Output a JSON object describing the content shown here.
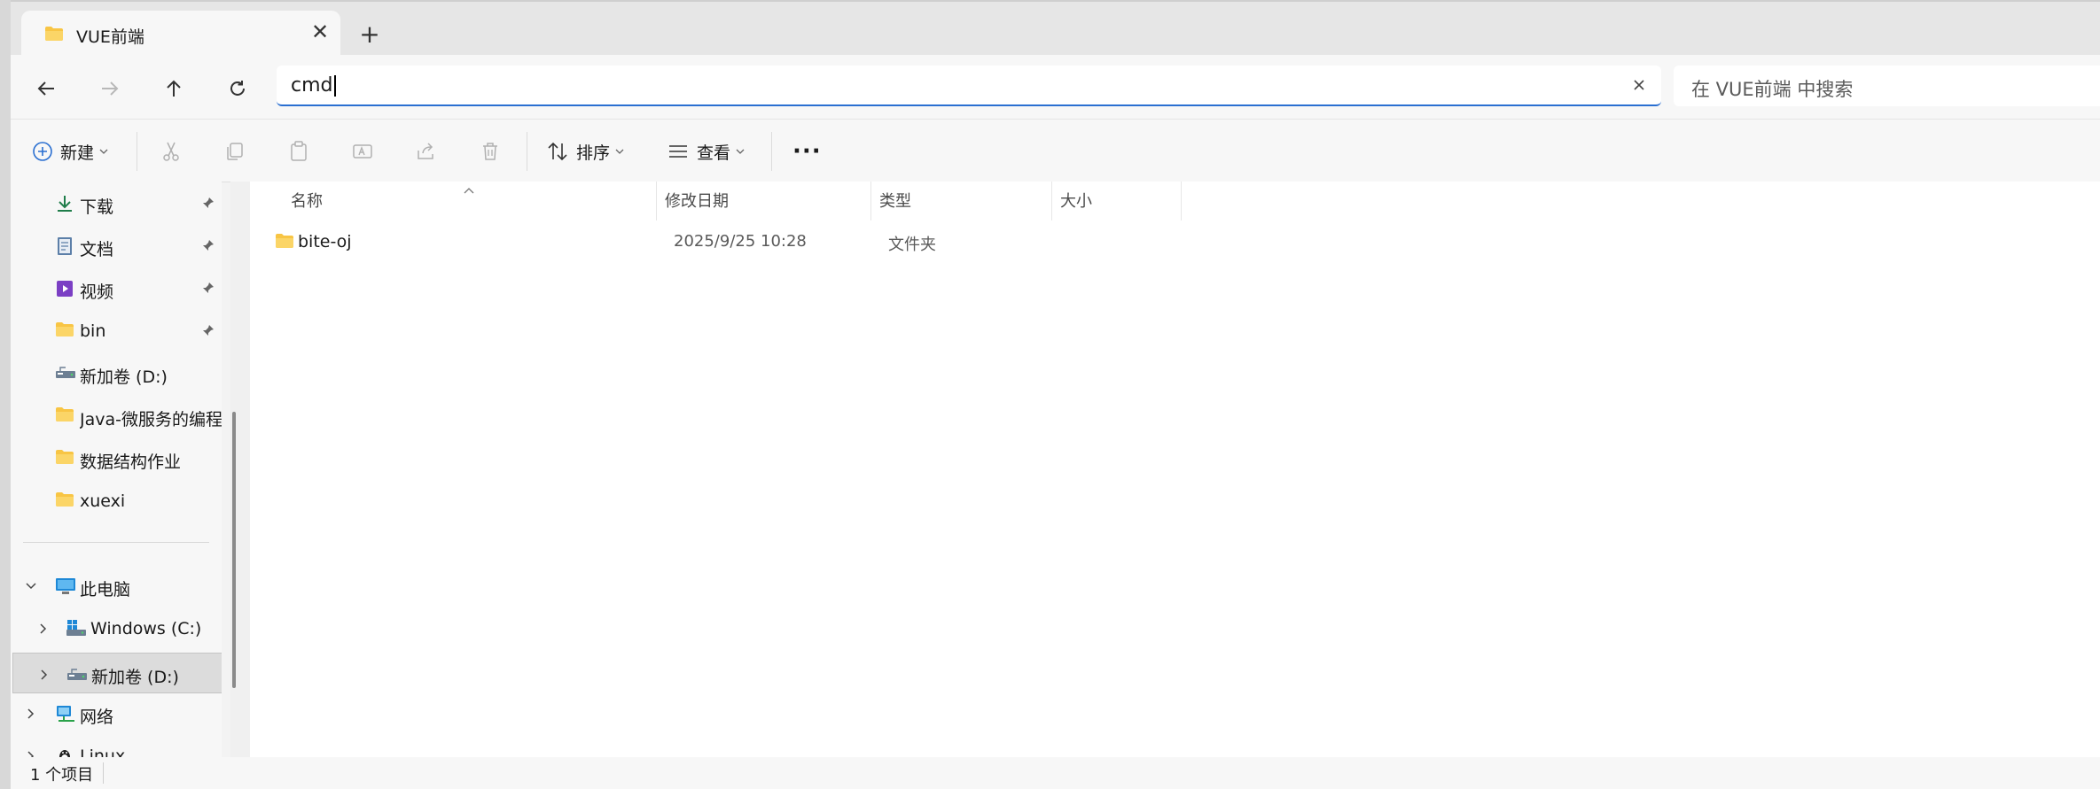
{
  "tab": {
    "title": "VUE前端",
    "close": "✕",
    "new_tab": "+"
  },
  "address": {
    "value": "cmd"
  },
  "search": {
    "placeholder": "在 VUE前端 中搜索"
  },
  "toolbar": {
    "new_label": "新建",
    "sort_label": "排序",
    "view_label": "查看",
    "more": "···"
  },
  "sidebar": {
    "items": [
      {
        "label": "下载",
        "icon": "download-icon",
        "pinned": true
      },
      {
        "label": "文档",
        "icon": "document-icon",
        "pinned": true
      },
      {
        "label": "视频",
        "icon": "video-icon",
        "pinned": true
      },
      {
        "label": "bin",
        "icon": "folder-icon",
        "pinned": true
      },
      {
        "label": "新加卷 (D:)",
        "icon": "drive-icon",
        "pinned": false
      },
      {
        "label": "Java-微服务的编程题",
        "icon": "folder-icon",
        "pinned": false
      },
      {
        "label": "数据结构作业",
        "icon": "folder-icon",
        "pinned": false
      },
      {
        "label": "xuexi",
        "icon": "folder-icon",
        "pinned": false
      }
    ],
    "tree": [
      {
        "label": "此电脑",
        "icon": "computer-icon",
        "expanded": true
      },
      {
        "label": "Windows (C:)",
        "icon": "windows-drive-icon",
        "expanded": false
      },
      {
        "label": "新加卷 (D:)",
        "icon": "drive-icon",
        "expanded": false,
        "selected": true
      },
      {
        "label": "网络",
        "icon": "network-icon",
        "expanded": false
      },
      {
        "label": "Linux",
        "icon": "linux-icon",
        "expanded": false
      }
    ]
  },
  "columns": {
    "name": "名称",
    "date": "修改日期",
    "type": "类型",
    "size": "大小"
  },
  "files": [
    {
      "name": "bite-oj",
      "date": "2025/9/25 10:28",
      "type": "文件夹",
      "size": ""
    }
  ],
  "status": {
    "count": "1 个项目"
  },
  "colors": {
    "accent": "#2a6fd1",
    "folder": "#f8c544"
  }
}
